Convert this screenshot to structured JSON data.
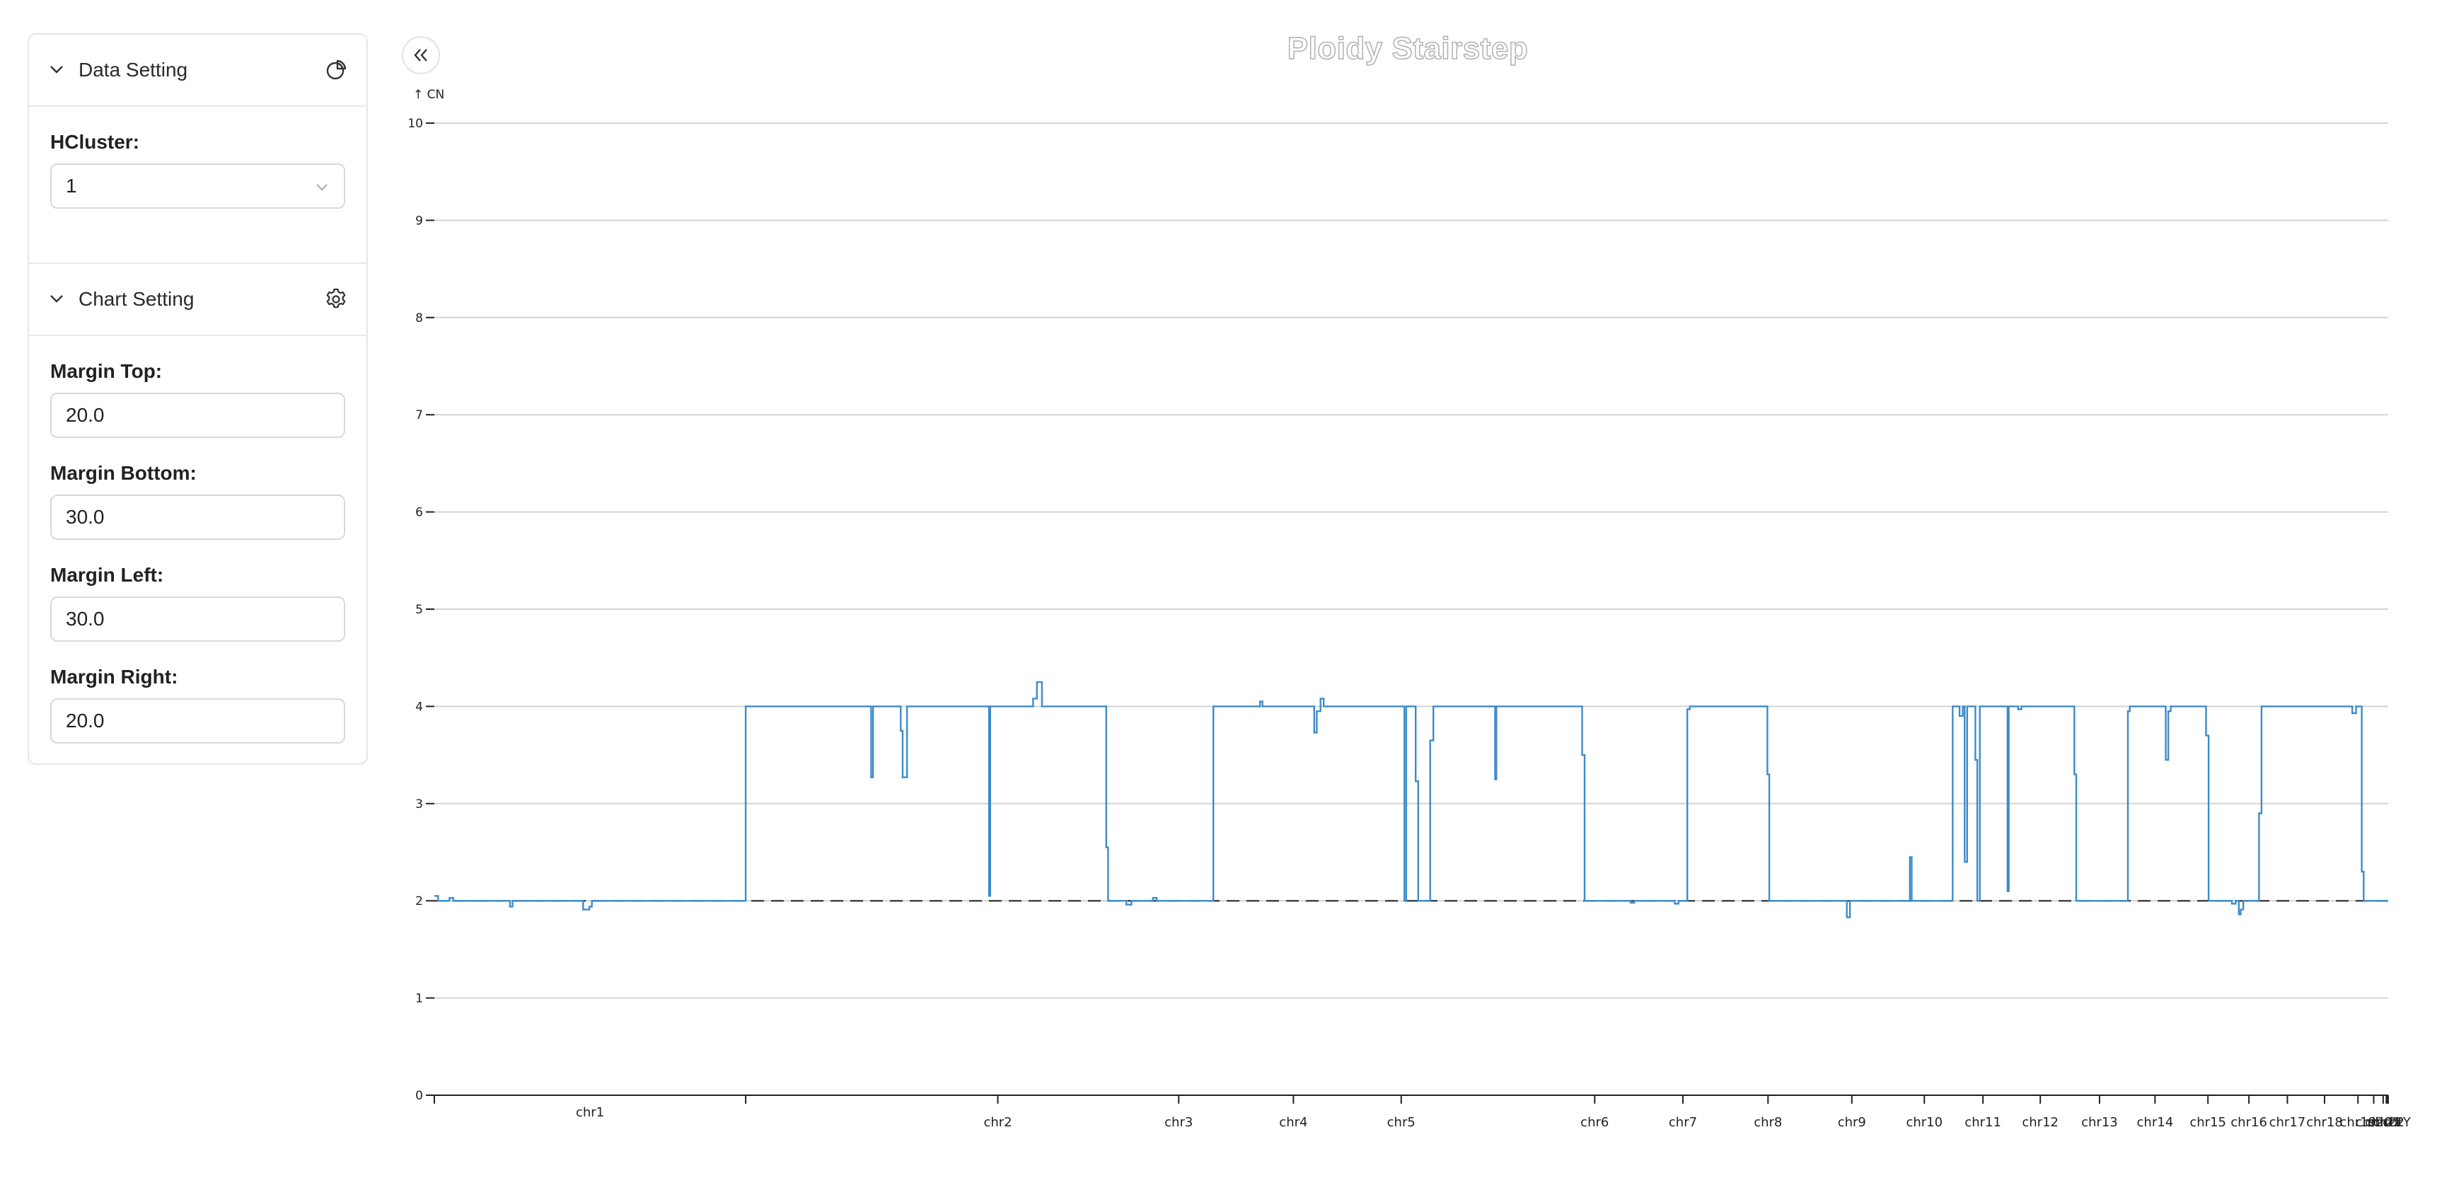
{
  "sidebar": {
    "data_setting": {
      "title": "Data Setting",
      "hcluster_label": "HCluster:",
      "hcluster_value": "1"
    },
    "chart_setting": {
      "title": "Chart Setting",
      "margin_top_label": "Margin Top:",
      "margin_top_value": "20.0",
      "margin_bottom_label": "Margin Bottom:",
      "margin_bottom_value": "30.0",
      "margin_left_label": "Margin Left:",
      "margin_left_value": "30.0",
      "margin_right_label": "Margin Right:",
      "margin_right_value": "20.0"
    }
  },
  "colors": {
    "line": "#3d8bc9",
    "grid": "#d3d3d3",
    "axis": "#222222",
    "baseline": "#444444"
  },
  "chart_data": {
    "type": "line",
    "title": "Ploidy Stairstep",
    "ylabel": "CN",
    "xlabel": "",
    "ylim": [
      0,
      10
    ],
    "yticks": [
      0,
      1,
      2,
      3,
      4,
      5,
      6,
      7,
      8,
      9,
      10
    ],
    "grid": true,
    "xlim": [
      0,
      3100
    ],
    "reference_line": {
      "y": 2,
      "style": "dashed"
    },
    "chromosomes": [
      {
        "name": "chr1",
        "start": 0,
        "end": 494
      },
      {
        "name": "chr2",
        "start": 494,
        "end": 894
      },
      {
        "name": "chr3",
        "start": 894,
        "end": 1181
      },
      {
        "name": "chr4",
        "start": 1181,
        "end": 1363
      },
      {
        "name": "chr5",
        "start": 1363,
        "end": 1534
      },
      {
        "name": "chr6",
        "start": 1534,
        "end": 1841
      },
      {
        "name": "chr7",
        "start": 1841,
        "end": 1981
      },
      {
        "name": "chr8",
        "start": 1981,
        "end": 2116
      },
      {
        "name": "chr9",
        "start": 2116,
        "end": 2249
      },
      {
        "name": "chr10",
        "start": 2249,
        "end": 2364
      },
      {
        "name": "chr11",
        "start": 2364,
        "end": 2457
      },
      {
        "name": "chr12",
        "start": 2457,
        "end": 2548
      },
      {
        "name": "chr13",
        "start": 2548,
        "end": 2642
      },
      {
        "name": "chr14",
        "start": 2642,
        "end": 2730
      },
      {
        "name": "chr15",
        "start": 2730,
        "end": 2814
      },
      {
        "name": "chr16",
        "start": 2814,
        "end": 2879
      },
      {
        "name": "chr17",
        "start": 2879,
        "end": 2940
      },
      {
        "name": "chr18",
        "start": 2940,
        "end": 2999
      },
      {
        "name": "chr19",
        "start": 2999,
        "end": 3052
      },
      {
        "name": "chr20",
        "start": 3052,
        "end": 3077
      },
      {
        "name": "chr21",
        "start": 3077,
        "end": 3092
      },
      {
        "name": "chr22",
        "start": 3092,
        "end": 3097
      },
      {
        "name": "chrX",
        "start": 3097,
        "end": 3099
      },
      {
        "name": "chrY",
        "start": 3099,
        "end": 3100
      }
    ],
    "steps": [
      [
        0,
        2.05
      ],
      [
        6,
        2.0
      ],
      [
        24,
        2.03
      ],
      [
        30,
        2.0
      ],
      [
        120,
        1.94
      ],
      [
        124,
        2.0
      ],
      [
        236,
        1.91
      ],
      [
        246,
        1.94
      ],
      [
        250,
        2.0
      ],
      [
        494,
        4.0
      ],
      [
        693,
        3.27
      ],
      [
        696,
        4.0
      ],
      [
        740,
        3.75
      ],
      [
        743,
        3.27
      ],
      [
        750,
        4.0
      ],
      [
        880,
        2.05
      ],
      [
        882,
        4.0
      ],
      [
        950,
        4.08
      ],
      [
        956,
        4.25
      ],
      [
        964,
        4.0
      ],
      [
        1066,
        2.55
      ],
      [
        1069,
        2.0
      ],
      [
        1098,
        1.96
      ],
      [
        1106,
        2.0
      ],
      [
        1140,
        2.03
      ],
      [
        1146,
        2.0
      ],
      [
        1236,
        4.0
      ],
      [
        1310,
        4.05
      ],
      [
        1314,
        4.0
      ],
      [
        1396,
        3.73
      ],
      [
        1400,
        3.95
      ],
      [
        1406,
        4.08
      ],
      [
        1411,
        4.0
      ],
      [
        1539,
        2.0
      ],
      [
        1542,
        4.0
      ],
      [
        1557,
        3.23
      ],
      [
        1561,
        2.0
      ],
      [
        1580,
        3.65
      ],
      [
        1585,
        4.0
      ],
      [
        1683,
        3.25
      ],
      [
        1685,
        4.0
      ],
      [
        1821,
        3.5
      ],
      [
        1825,
        2.0
      ],
      [
        1898,
        1.98
      ],
      [
        1904,
        2.0
      ],
      [
        1968,
        1.97
      ],
      [
        1974,
        2.0
      ],
      [
        1988,
        3.97
      ],
      [
        1992,
        4.0
      ],
      [
        2115,
        3.3
      ],
      [
        2118,
        2.0
      ],
      [
        2241,
        1.83
      ],
      [
        2246,
        2.0
      ],
      [
        2341,
        2.45
      ],
      [
        2344,
        2.0
      ],
      [
        2409,
        4.0
      ],
      [
        2420,
        3.9
      ],
      [
        2425,
        4.0
      ],
      [
        2428,
        2.4
      ],
      [
        2432,
        4.0
      ],
      [
        2445,
        3.45
      ],
      [
        2448,
        2.0
      ],
      [
        2452,
        4.0
      ],
      [
        2496,
        2.1
      ],
      [
        2498,
        4.0
      ],
      [
        2513,
        3.97
      ],
      [
        2518,
        4.0
      ],
      [
        2602,
        3.3
      ],
      [
        2605,
        2.0
      ],
      [
        2687,
        3.95
      ],
      [
        2690,
        4.0
      ],
      [
        2747,
        3.45
      ],
      [
        2751,
        3.95
      ],
      [
        2755,
        4.0
      ],
      [
        2811,
        3.7
      ],
      [
        2815,
        2.0
      ],
      [
        2852,
        1.97
      ],
      [
        2858,
        2.0
      ],
      [
        2863,
        1.86
      ],
      [
        2866,
        1.91
      ],
      [
        2870,
        2.0
      ],
      [
        2895,
        2.9
      ],
      [
        2899,
        4.0
      ],
      [
        3043,
        3.93
      ],
      [
        3049,
        4.0
      ],
      [
        3058,
        2.3
      ],
      [
        3061,
        2.0
      ],
      [
        3100,
        2.0
      ]
    ]
  }
}
